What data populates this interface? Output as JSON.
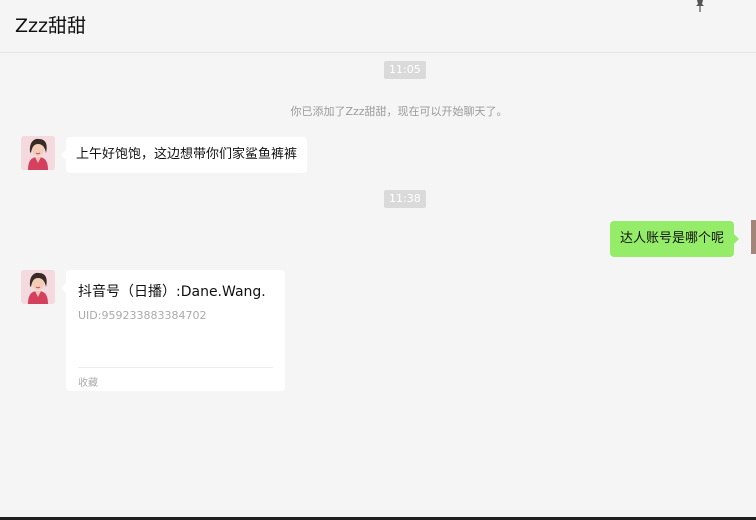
{
  "chat": {
    "contact_name": "Zzz甜甜"
  },
  "messages": {
    "time_1": "11:05",
    "system_notice": "你已添加了Zzz甜甜，现在可以开始聊天了。",
    "msg_1": "上午好饱饱，这边想带你们家鲨鱼裤裤",
    "time_2": "11:38",
    "msg_2": "达人账号是哪个呢",
    "card": {
      "title": "抖音号（日播）:Dane.Wang.",
      "uid": "UID:959233883384702",
      "footer": "收藏"
    }
  },
  "icons": {
    "pin": "pin-icon",
    "contact_avatar": "avatar-woman-illustration",
    "self_avatar": "avatar-self"
  },
  "colors": {
    "background": "#f5f5f5",
    "incoming_bubble": "#ffffff",
    "outgoing_bubble": "#95ec69",
    "time_badge": "#dadada",
    "system_text": "#9b9b9b"
  }
}
